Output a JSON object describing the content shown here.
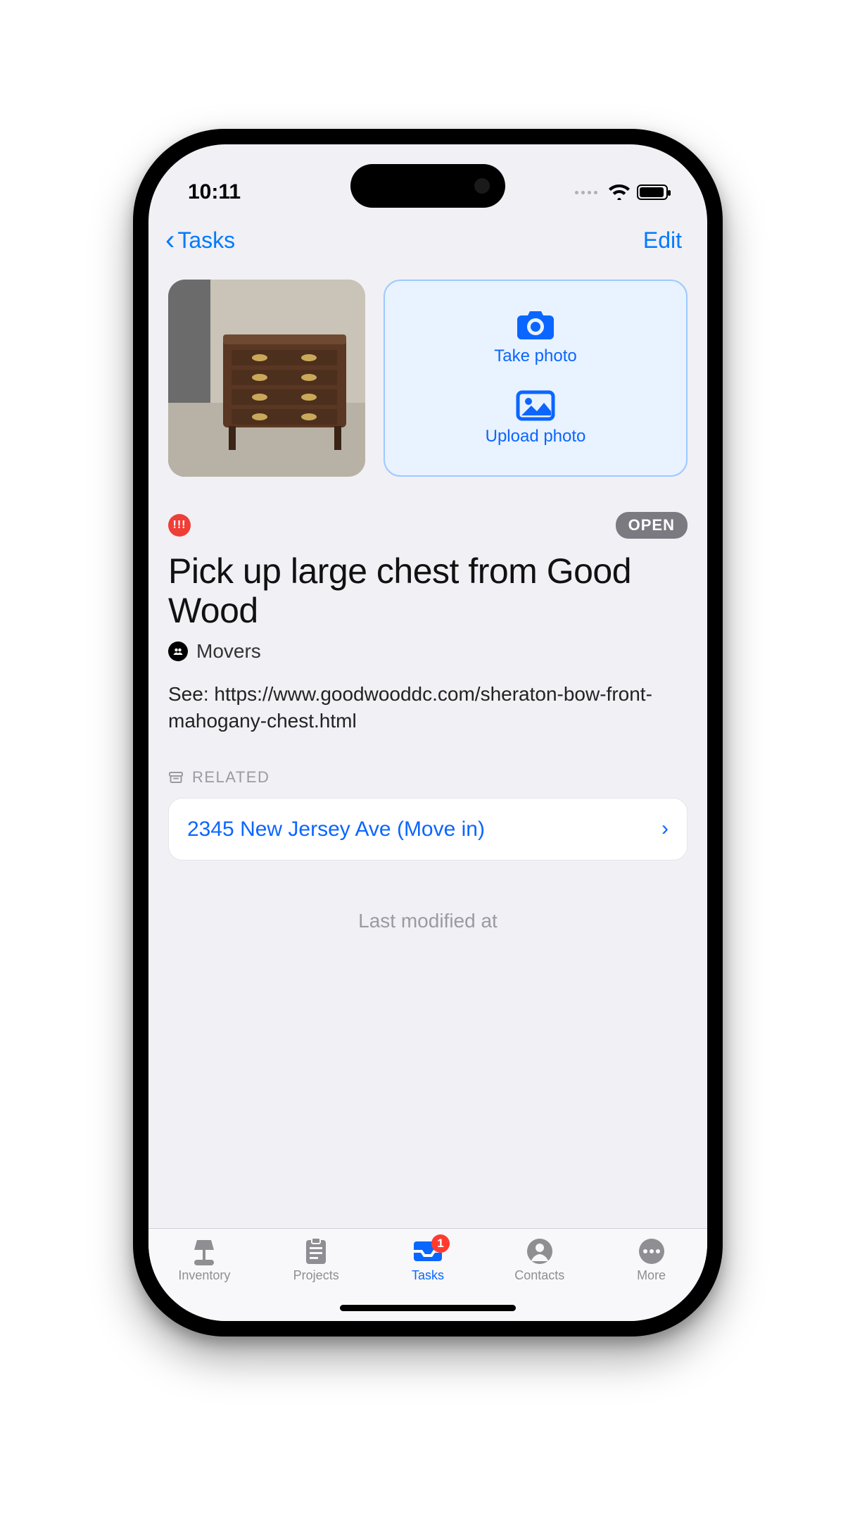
{
  "statusbar": {
    "time": "10:11"
  },
  "nav": {
    "back_label": "Tasks",
    "edit_label": "Edit"
  },
  "photo_actions": {
    "take": "Take photo",
    "upload": "Upload photo"
  },
  "priority_badge": "!!!",
  "status_badge": "OPEN",
  "task_title": "Pick up large chest from Good Wood",
  "assignee": "Movers",
  "description": "See: https://www.goodwooddc.com/sheraton-bow-front-mahogany-chest.html",
  "related": {
    "heading": "RELATED",
    "item": "2345 New Jersey Ave (Move in)"
  },
  "last_modified_label": "Last modified at",
  "tabs": {
    "inventory": "Inventory",
    "projects": "Projects",
    "tasks": "Tasks",
    "contacts": "Contacts",
    "more": "More",
    "tasks_badge": "1"
  }
}
